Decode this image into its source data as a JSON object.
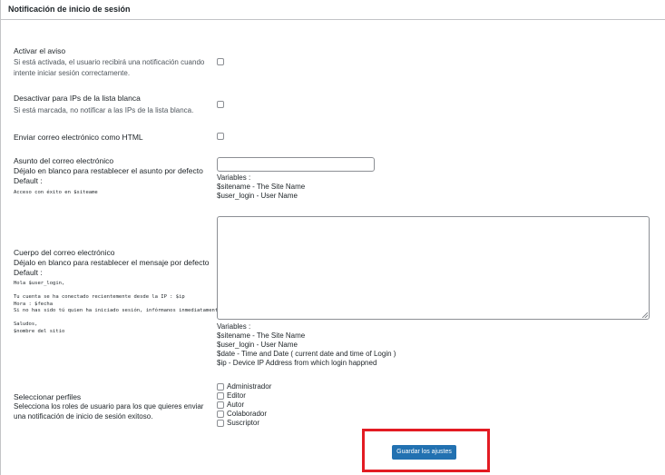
{
  "panel": {
    "title": "Notificación de inicio de sesión"
  },
  "activate": {
    "label": "Activar el aviso",
    "description": "Si está activada, el usuario recibirá una notificación cuando intente iniciar sesión correctamente.",
    "checked": false
  },
  "whitelist": {
    "label": "Desactivar para IPs de la lista blanca",
    "description": "Si está marcada, no notificar a las IPs de la lista blanca.",
    "checked": false
  },
  "html_email": {
    "label": "Enviar correo electrónico como HTML",
    "checked": false
  },
  "subject": {
    "label": "Asunto del correo electrónico",
    "hint": "Déjalo en blanco para restablecer el asunto por defecto",
    "default_label": "Default :",
    "default_value": "Acceso con éxito en $siteame",
    "value": "",
    "variables_title": "Variables :",
    "variables": [
      "$sitename - The Site Name",
      "$user_login - User Name"
    ]
  },
  "body": {
    "label": "Cuerpo del correo electrónico",
    "hint": "Déjalo en blanco para restablecer el mensaje por defecto",
    "default_label": "Default :",
    "default_value": "Hola $user_login,\n\nTu cuenta se ha conectado recientemente desde la IP : $ip\nHora : $fecha\nSi no has sido tú quien ha iniciado sesión, infórmanos inmediatamente.\n\nSaludos,\n$nombre del sitio",
    "value": "",
    "variables_title": "Variables :",
    "variables": [
      "$sitename - The Site Name",
      "$user_login - User Name",
      "$date - Time and Date ( current date and time of Login )",
      "$ip - Device IP Address from which login happned"
    ]
  },
  "roles": {
    "label": "Seleccionar perfiles",
    "description": "Selecciona los roles de usuario para los que quieres enviar una notificación de inicio de sesión exitoso.",
    "items": [
      {
        "label": "Administrador",
        "checked": false
      },
      {
        "label": "Editor",
        "checked": false
      },
      {
        "label": "Autor",
        "checked": false
      },
      {
        "label": "Colaborador",
        "checked": false
      },
      {
        "label": "Suscriptor",
        "checked": false
      }
    ]
  },
  "actions": {
    "save_label": "Guardar los ajustes"
  },
  "colors": {
    "primary_button": "#2271b1",
    "highlight": "#e31b23",
    "border": "#c3c4c7"
  }
}
